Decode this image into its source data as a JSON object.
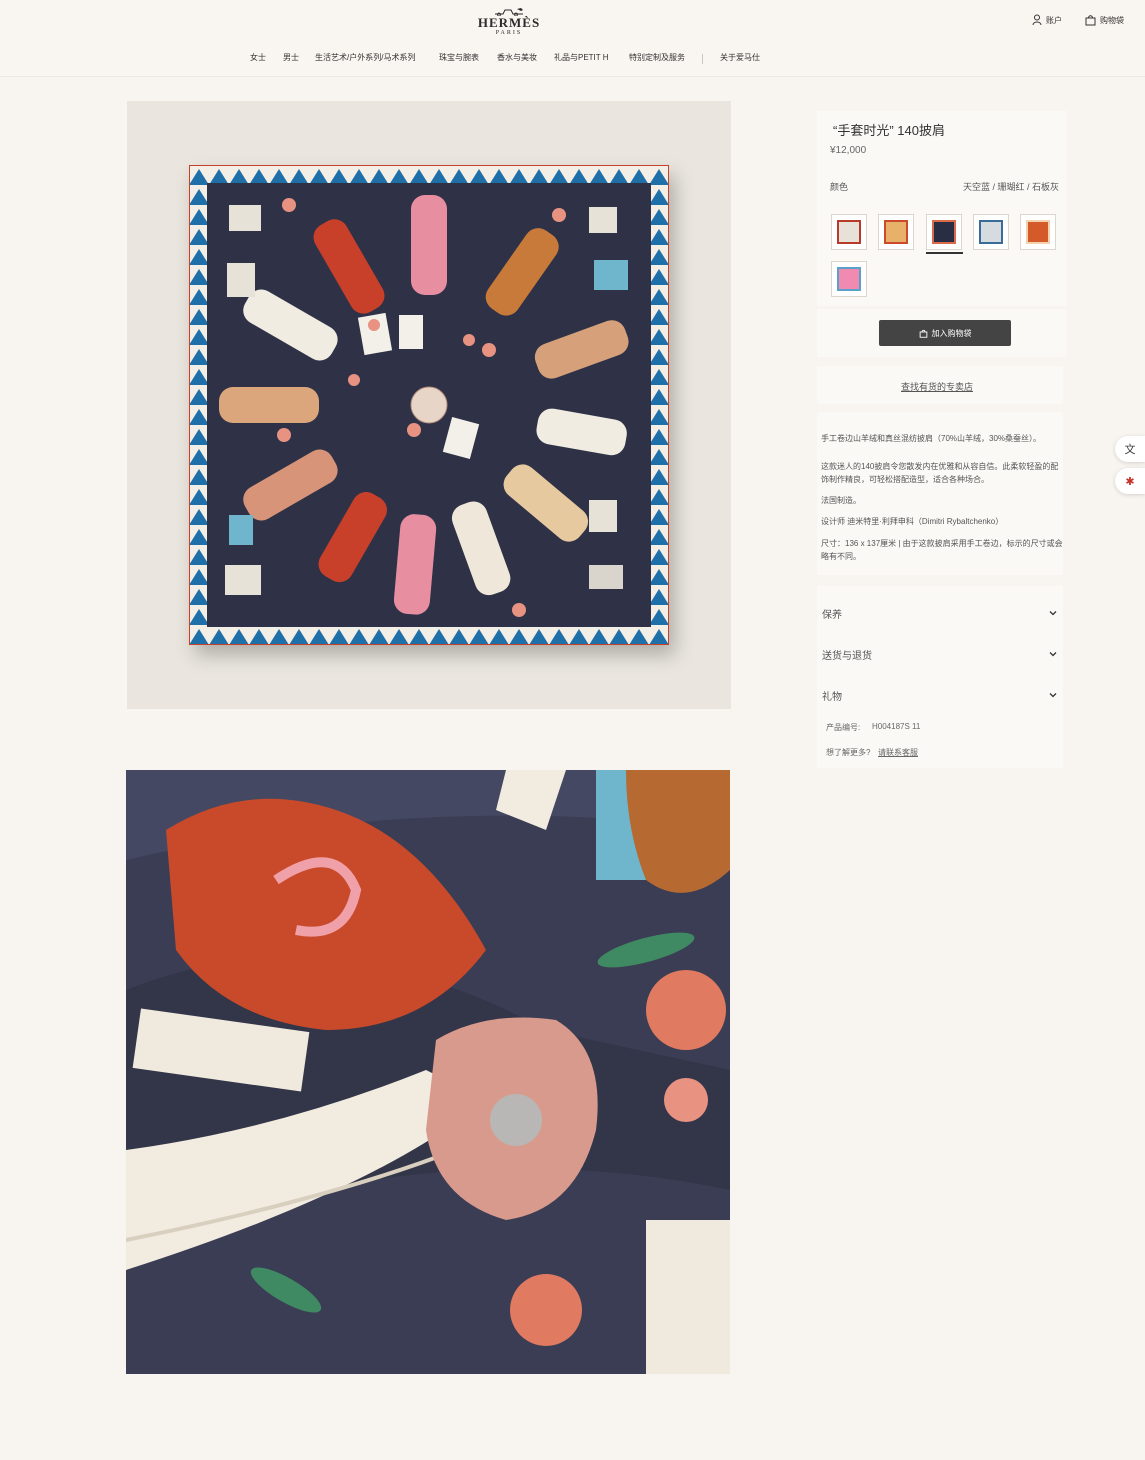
{
  "header": {
    "logo_text": "HERMÈS",
    "logo_sub": "PARIS",
    "nav": [
      "女士",
      "男士",
      "生活艺术/户外系列/马术系列",
      "珠宝与腕表",
      "香水与美妆",
      "礼品与PETIT H",
      "特别定制及服务",
      "关于爱马仕"
    ],
    "account_label": "账户",
    "bag_label": "购物袋"
  },
  "product": {
    "title": "“手套时光” 140披肩",
    "price": "¥12,000",
    "color_label": "颜色",
    "color_value": "天空蓝 / 珊瑚红 / 石板灰",
    "swatches": [
      {
        "name": "swatch-1",
        "color": "#e7e1d7",
        "accent": "#b83a2a"
      },
      {
        "name": "swatch-2",
        "color": "#e9b06a",
        "accent": "#c94a2f"
      },
      {
        "name": "swatch-3",
        "color": "#2a2e45",
        "accent": "#d86b4a"
      },
      {
        "name": "swatch-4",
        "color": "#d6dbe0",
        "accent": "#3a6c9a"
      },
      {
        "name": "swatch-5",
        "color": "#d45a2a",
        "accent": "#f1d3b0"
      },
      {
        "name": "swatch-6",
        "color": "#f08ab0",
        "accent": "#5aa0c8"
      }
    ],
    "add_to_bag": "加入购物袋",
    "find_store": "查找有货的专卖店",
    "description": [
      "手工卷边山羊绒和真丝混纺披肩（70%山羊绒，30%桑蚕丝）。",
      "这款迷人的140披肩令您散发内在优雅和从容自信。此柔软轻盈的配饰制作精良，可轻松搭配造型，适合各种场合。",
      "法国制造。",
      "设计师 迪米特里·利拜申科（Dimitri Rybaltchenko）",
      "尺寸：136 x 137厘米 | 由于这款披肩采用手工卷边，标示的尺寸或会略有不同。"
    ],
    "accordions": [
      "保养",
      "送货与退货",
      "礼物"
    ],
    "product_code_label": "产品编号:",
    "product_code": "H004187S 11",
    "help_label": "想了解更多?",
    "help_link": "请联系客服"
  }
}
